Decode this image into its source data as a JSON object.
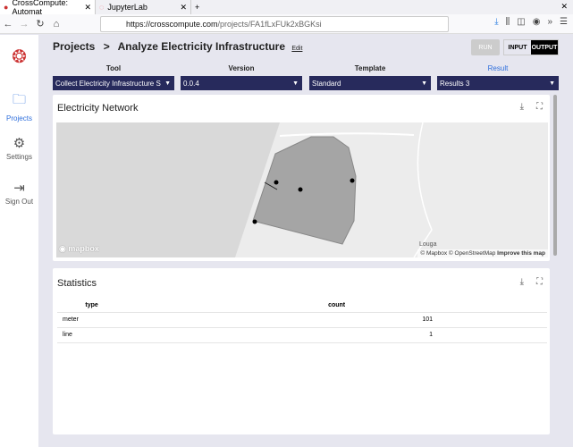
{
  "browser": {
    "tabs": [
      {
        "title": "CrossCompute: Automat",
        "active": true
      },
      {
        "title": "JupyterLab",
        "active": false
      }
    ],
    "url_host": "https://crosscompute.com",
    "url_path": "/projects/FA1fLxFUk2xBGKsi"
  },
  "sidebar": {
    "items": [
      {
        "label": "Projects",
        "icon": "folder-icon",
        "active": true
      },
      {
        "label": "Settings",
        "icon": "gear-icon"
      },
      {
        "label": "Sign Out",
        "icon": "sign-out-icon"
      }
    ]
  },
  "header": {
    "breadcrumb_root": "Projects",
    "separator": ">",
    "title": "Analyze Electricity Infrastructure",
    "edit": "Edit"
  },
  "toolbar": {
    "run": "RUN",
    "input": "INPUT",
    "output": "OUTPUT"
  },
  "selectors": [
    {
      "label": "Tool",
      "value": "Collect Electricity Infrastructure S"
    },
    {
      "label": "Version",
      "value": "0.0.4"
    },
    {
      "label": "Template",
      "value": "Standard"
    },
    {
      "label": "Result",
      "value": "Results 3"
    }
  ],
  "map_card": {
    "title": "Electricity Network",
    "place_label": "Louga",
    "logo": "mapbox",
    "attribution": "© Mapbox © OpenStreetMap",
    "improve": "Improve this map"
  },
  "stats_card": {
    "title": "Statistics",
    "columns": [
      "type",
      "count"
    ],
    "rows": [
      [
        "meter",
        "101"
      ],
      [
        "line",
        "1"
      ]
    ]
  },
  "colors": {
    "accent": "#272a5c",
    "link": "#2f6fdc"
  }
}
